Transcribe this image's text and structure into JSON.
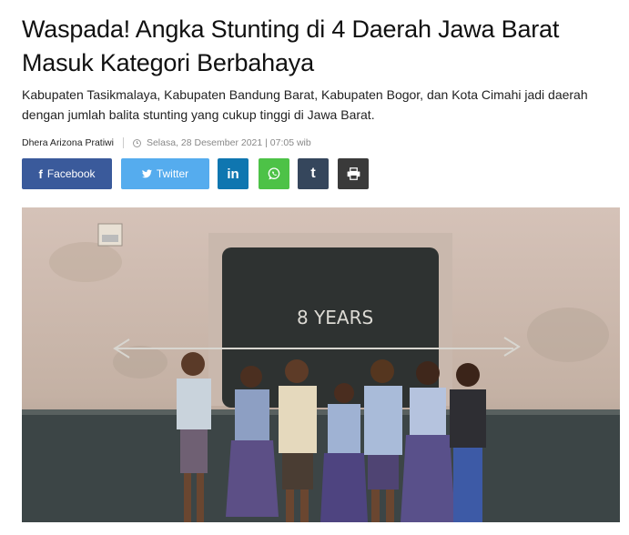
{
  "article": {
    "title": "Waspada! Angka Stunting di 4 Daerah Jawa Barat Masuk Kategori Berbahaya",
    "lede": "Kabupaten Tasikmalaya, Kabupaten Bandung Barat, Kabupaten Bogor, dan Kota Cimahi jadi daerah dengan jumlah balita stunting yang cukup tinggi di Jawa Barat.",
    "author": "Dhera Arizona Pratiwi",
    "datetime": "Selasa, 28 Desember 2021 | 07:05 wib"
  },
  "share": {
    "facebook_label": "Facebook",
    "twitter_label": "Twitter",
    "linkedin_glyph": "in",
    "tumblr_glyph": "t",
    "colors": {
      "facebook": "#3a5a9b",
      "twitter": "#55acee",
      "linkedin": "#0f76b0",
      "whatsapp": "#4dc247",
      "tumblr": "#35465c",
      "print": "#3a3a3a"
    }
  },
  "photo": {
    "chalk_text": "8 YEARS"
  }
}
